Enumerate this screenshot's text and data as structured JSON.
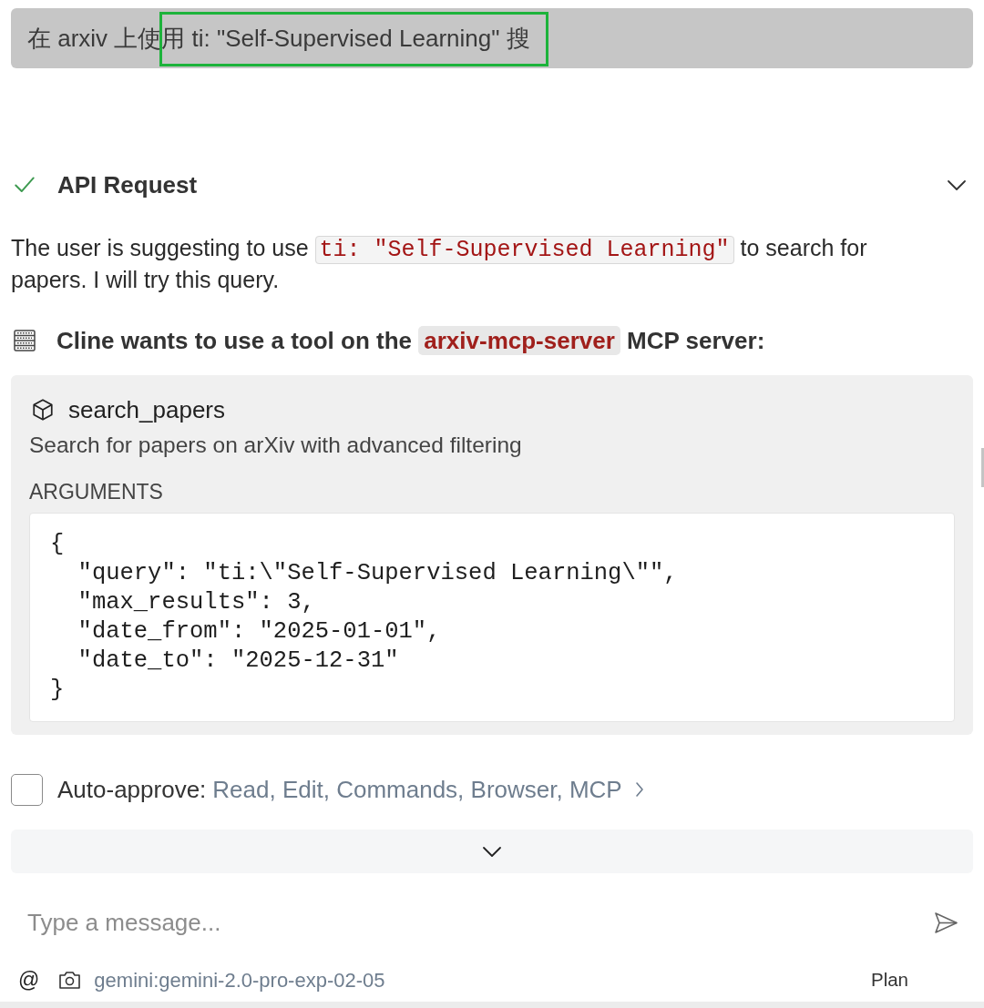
{
  "user_message": {
    "text": "在 arxiv 上使用 ti: \"Self-Supervised Learning\" 搜",
    "highlighted": true
  },
  "api_request": {
    "title": "API Request",
    "completed": true
  },
  "reasoning": [
    {
      "kind": "text",
      "text": "The user is suggesting to use "
    },
    {
      "kind": "code",
      "text": "ti: \"Self-Supervised Learning\""
    },
    {
      "kind": "text",
      "text": " to search for papers. I will try this query."
    }
  ],
  "tool_notice": [
    {
      "kind": "text",
      "text": "Cline wants to use a tool on the "
    },
    {
      "kind": "code",
      "text": "arxiv-mcp-server"
    },
    {
      "kind": "text",
      "text": " MCP server:"
    }
  ],
  "tool": {
    "name": "search_papers",
    "description": "Search for papers on arXiv with advanced filtering",
    "arguments_label": "ARGUMENTS",
    "arguments": "{\n  \"query\": \"ti:\\\"Self-Supervised Learning\\\"\",\n  \"max_results\": 3,\n  \"date_from\": \"2025-01-01\",\n  \"date_to\": \"2025-12-31\"\n}"
  },
  "auto_approve": {
    "checked": false,
    "label": "Auto-approve:",
    "value": "Read, Edit, Commands, Browser, MCP"
  },
  "message_input": {
    "placeholder": "Type a message..."
  },
  "footer": {
    "mention": "@",
    "model": "gemini:gemini-2.0-pro-exp-02-05",
    "mode": "Plan"
  }
}
